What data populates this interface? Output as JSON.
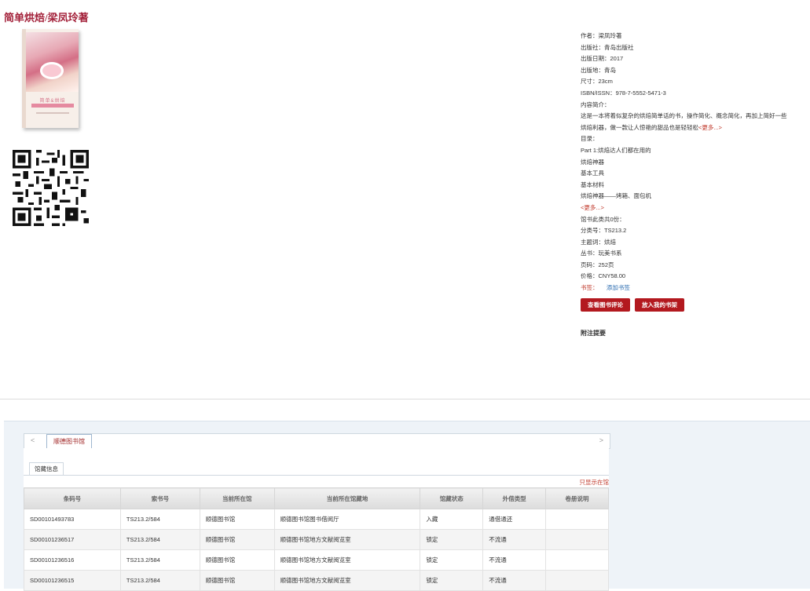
{
  "title": "简单烘焙/梁凤玲著",
  "cover": {
    "line1": "简单&烘焙"
  },
  "info": {
    "author": "作者：梁凤玲著",
    "publisher": "出版社：青岛出版社",
    "pubdate": "出版日期：2017",
    "place": "出版地：青岛",
    "size": "尺寸：23cm",
    "isbn": "ISBN/ISSN：978-7-5552-5471-3",
    "intro_label": "内容简介：",
    "intro_1": "这是一本将着似复杂的烘焙简单话的书，操作简化、概念简化，再加上简好一些",
    "intro_2": "烘焙利器，做一款让人惊艳的甜品也是轻轻松",
    "more": "<更多...>",
    "toc_label": "目录：",
    "toc_1": "Part 1:烘焙达人们都在用的",
    "toc_2": "烘焙神器",
    "toc_3": "基本工具",
    "toc_4": "基本材料",
    "toc_5": "烘焙神器——烤箱、面包机",
    "toc_more": "<更多...>",
    "copies": "馆书此类共0份：",
    "classno": "分类号：TS213.2",
    "subject": "主题词：烘焙",
    "series": "丛书：玩美书系",
    "pages": "页码：252页",
    "price": "价格：CNY58.00",
    "tag_label": "书签：",
    "tag_add": "添加书签"
  },
  "buttons": {
    "review": "查看图书评论",
    "shelf": "放入我的书架"
  },
  "attachment": "附注提要",
  "holdings": {
    "arrow_left": "<",
    "arrow_right": ">",
    "library_tab": "顺德图书馆",
    "subtab": "馆藏信息",
    "only": "只显示在馆",
    "headers": [
      "条码号",
      "索书号",
      "当前所在馆",
      "当前所在馆藏地",
      "馆藏状态",
      "外借类型",
      "卷册说明"
    ],
    "rows": [
      [
        "SD00101493783",
        "TS213.2/584",
        "顺德图书馆",
        "顺德图书馆图书借阅厅",
        "入藏",
        "通借通还",
        ""
      ],
      [
        "SD00101236517",
        "TS213.2/584",
        "顺德图书馆",
        "顺德图书馆地方文献阅览室",
        "锁定",
        "不流通",
        ""
      ],
      [
        "SD00101236516",
        "TS213.2/584",
        "顺德图书馆",
        "顺德图书馆地方文献阅览室",
        "锁定",
        "不流通",
        ""
      ],
      [
        "SD00101236515",
        "TS213.2/584",
        "顺德图书馆",
        "顺德图书馆地方文献阅览室",
        "锁定",
        "不流通",
        ""
      ]
    ]
  }
}
